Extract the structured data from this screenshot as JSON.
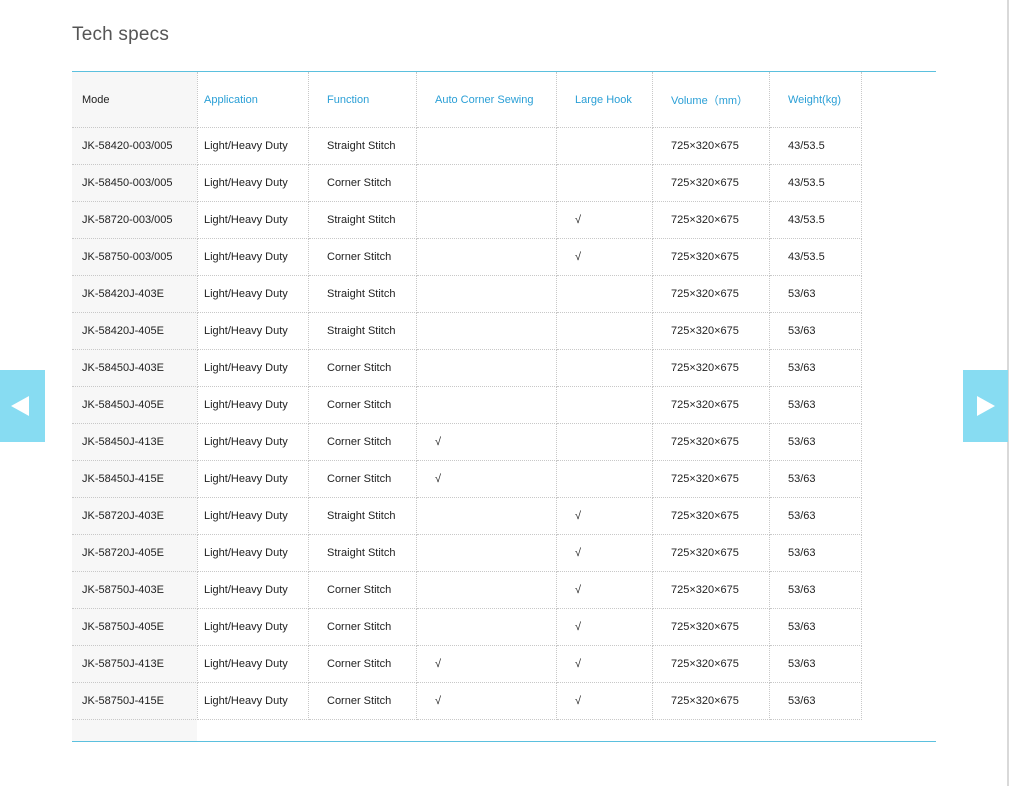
{
  "section": {
    "title": "Tech specs"
  },
  "nav": {
    "prev_icon": "triangle-left-icon",
    "next_icon": "triangle-right-icon",
    "color": "#87dcf2"
  },
  "colors": {
    "accent": "#2a9fd6",
    "rule": "#5bc0de",
    "mode_column_bg": "#f7f7f7"
  },
  "table": {
    "headers": [
      "Mode",
      "Application",
      "Function",
      "Auto Corner Sewing",
      "Large Hook",
      "Volume（mm）",
      "Weight(kg)"
    ],
    "rows": [
      [
        "JK-58420-003/005",
        "Light/Heavy Duty",
        "Straight Stitch",
        "",
        "",
        "725×320×675",
        "43/53.5"
      ],
      [
        "JK-58450-003/005",
        "Light/Heavy Duty",
        "Corner Stitch",
        "",
        "",
        "725×320×675",
        "43/53.5"
      ],
      [
        "JK-58720-003/005",
        "Light/Heavy Duty",
        "Straight Stitch",
        "",
        "√",
        "725×320×675",
        "43/53.5"
      ],
      [
        "JK-58750-003/005",
        "Light/Heavy Duty",
        "Corner Stitch",
        "",
        "√",
        "725×320×675",
        "43/53.5"
      ],
      [
        "JK-58420J-403E",
        "Light/Heavy Duty",
        "Straight Stitch",
        "",
        "",
        "725×320×675",
        "53/63"
      ],
      [
        "JK-58420J-405E",
        "Light/Heavy Duty",
        "Straight Stitch",
        "",
        "",
        "725×320×675",
        "53/63"
      ],
      [
        "JK-58450J-403E",
        "Light/Heavy Duty",
        "Corner Stitch",
        "",
        "",
        "725×320×675",
        "53/63"
      ],
      [
        "JK-58450J-405E",
        "Light/Heavy Duty",
        "Corner Stitch",
        "",
        "",
        "725×320×675",
        "53/63"
      ],
      [
        "JK-58450J-413E",
        "Light/Heavy Duty",
        "Corner Stitch",
        "√",
        "",
        "725×320×675",
        "53/63"
      ],
      [
        "JK-58450J-415E",
        "Light/Heavy Duty",
        "Corner Stitch",
        "√",
        "",
        "725×320×675",
        "53/63"
      ],
      [
        "JK-58720J-403E",
        "Light/Heavy Duty",
        "Straight Stitch",
        "",
        "√",
        "725×320×675",
        "53/63"
      ],
      [
        "JK-58720J-405E",
        "Light/Heavy Duty",
        "Straight Stitch",
        "",
        "√",
        "725×320×675",
        "53/63"
      ],
      [
        "JK-58750J-403E",
        "Light/Heavy Duty",
        "Corner Stitch",
        "",
        "√",
        "725×320×675",
        "53/63"
      ],
      [
        "JK-58750J-405E",
        "Light/Heavy Duty",
        "Corner Stitch",
        "",
        "√",
        "725×320×675",
        "53/63"
      ],
      [
        "JK-58750J-413E",
        "Light/Heavy Duty",
        "Corner  Stitch",
        "√",
        "√",
        "725×320×675",
        "53/63"
      ],
      [
        "JK-58750J-415E",
        "Light/Heavy Duty",
        "Corner Stitch",
        "√",
        "√",
        "725×320×675",
        "53/63"
      ]
    ]
  }
}
